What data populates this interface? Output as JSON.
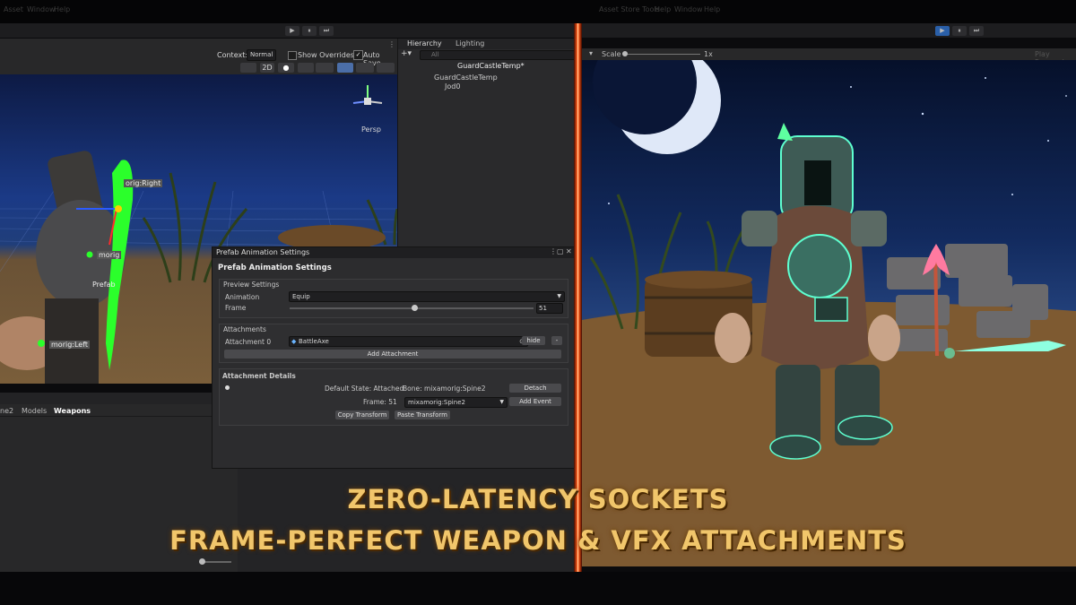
{
  "top_menu": [
    "Asset",
    "Window",
    "Help"
  ],
  "right_top_menu": [
    "Asset Store Tools",
    "Help",
    "Window",
    "Help"
  ],
  "play_controls": {
    "play": "▶",
    "pause": "⏸",
    "step": "⏭"
  },
  "scene_toolbar": {
    "context_label": "Context:",
    "context_value": "Normal",
    "show_overrides": "Show Overrides",
    "auto_save": "Auto Save",
    "mode_2d": "2D",
    "persp": "Persp"
  },
  "scene_labels": {
    "prefab": "Prefab",
    "bone_right": "orig:Right",
    "bone_mid": "morig",
    "bone_left": "morig:Left"
  },
  "hierarchy": {
    "tab_hierarchy": "Hierarchy",
    "tab_lighting": "Lighting",
    "search_placeholder": "All",
    "root": "GuardCastleTemp*",
    "child": "GuardCastleTemp",
    "grandchild": "Jod0"
  },
  "project": {
    "breadcrumb": [
      "ne2",
      "Models",
      "Weapons"
    ]
  },
  "window": {
    "title": "Prefab Animation Settings",
    "heading": "Prefab Animation Settings",
    "preview_section": "Preview Settings",
    "animation_label": "Animation",
    "animation_value": "Equip",
    "frame_label": "Frame",
    "frame_value": "51",
    "attachments_section": "Attachments",
    "attachment_label": "Attachment 0",
    "attachment_value": "BattleAxe",
    "hide_button": "hide",
    "remove_button": "-",
    "add_attachment": "Add Attachment",
    "details_section": "Attachment Details",
    "default_state": "Default State: Attached",
    "bone": "Bone: mixamorig:Spine2",
    "detach": "Detach",
    "frame_detail": "Frame: 51",
    "bone_select": "mixamorig:Spine2",
    "add_event": "Add Event",
    "copy_transform": "Copy Transform",
    "paste_transform": "Paste Transform"
  },
  "game_view": {
    "scale_label": "Scale",
    "scale_value": "1x",
    "play_focused": "Play Focused"
  },
  "captions": {
    "line1": "ZERO-LATENCY SOCKETS",
    "line2": "FRAME-PERFECT WEAPON & VFX ATTACHMENTS"
  },
  "colors": {
    "accent_divider": "#ff6a2a",
    "caption_gold": "#f1c66b",
    "gizmo_green": "#2bff2b",
    "glow_teal": "#5effd0"
  }
}
